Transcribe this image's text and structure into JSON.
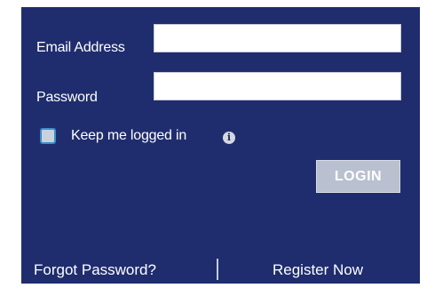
{
  "login_form": {
    "email_label": "Email Address",
    "email_value": "",
    "password_label": "Password",
    "password_value": "",
    "keep_logged_in_label": "Keep me logged in",
    "keep_logged_in_checked": false,
    "info_icon": "info-icon",
    "login_button_label": "LOGIN"
  },
  "footer": {
    "forgot_password_label": "Forgot Password?",
    "register_label": "Register Now"
  },
  "colors": {
    "panel_background": "#1f2d6e",
    "button_background": "#b9c0cf",
    "checkbox_border": "#3b8ec9",
    "text": "#ffffff"
  }
}
